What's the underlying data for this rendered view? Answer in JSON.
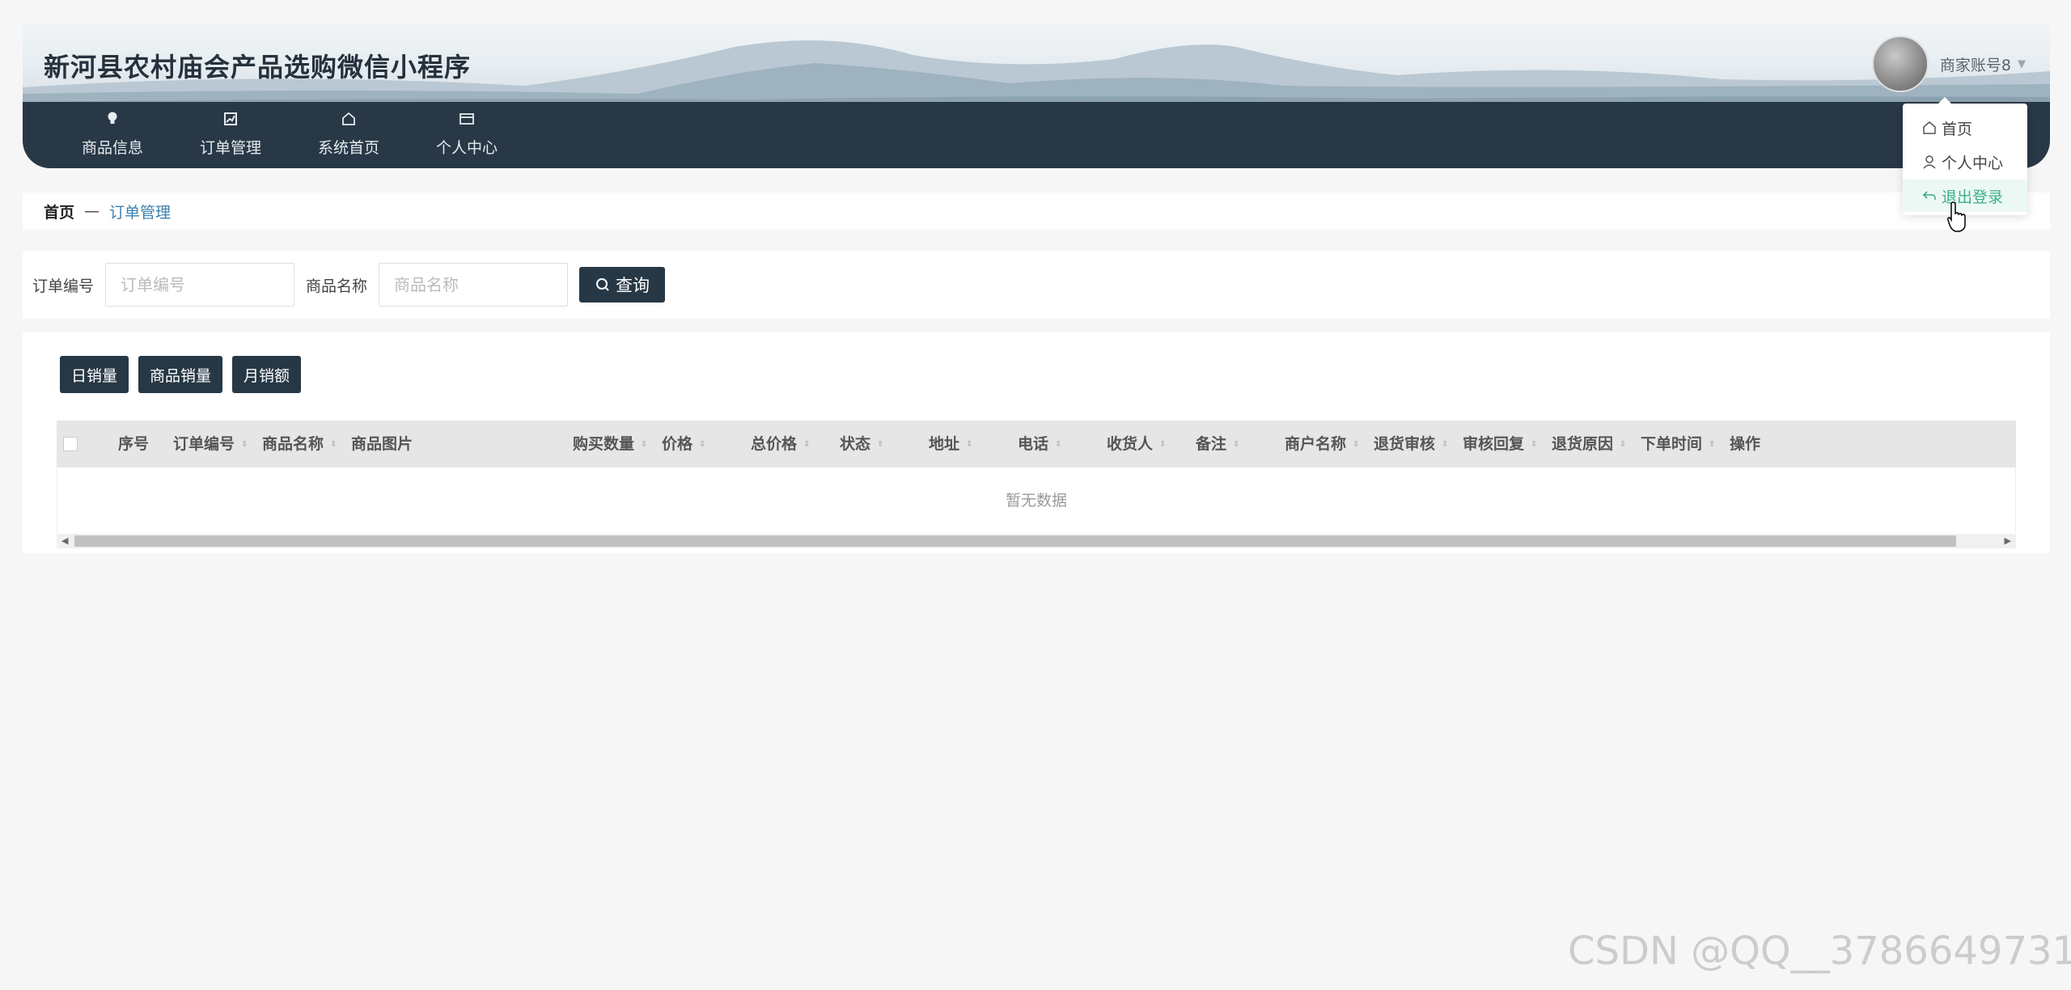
{
  "header": {
    "app_title": "新河县农村庙会产品选购微信小程序",
    "username": "商家账号8"
  },
  "nav": {
    "items": [
      {
        "label": "商品信息",
        "icon": "lightbulb-icon"
      },
      {
        "label": "订单管理",
        "icon": "chart-icon"
      },
      {
        "label": "系统首页",
        "icon": "home-icon"
      },
      {
        "label": "个人中心",
        "icon": "wallet-icon"
      }
    ]
  },
  "dropdown": {
    "items": [
      {
        "label": "首页",
        "icon": "home-icon"
      },
      {
        "label": "个人中心",
        "icon": "user-icon"
      },
      {
        "label": "退出登录",
        "icon": "logout-icon",
        "active": true
      }
    ],
    "active_color": "#3cae8c"
  },
  "breadcrumb": {
    "home": "首页",
    "separator": "—",
    "current": "订单管理"
  },
  "search": {
    "order_no_label": "订单编号",
    "order_no_placeholder": "订单编号",
    "order_no_value": "",
    "product_name_label": "商品名称",
    "product_name_placeholder": "商品名称",
    "product_name_value": "",
    "button_label": "查询"
  },
  "actions": {
    "daily_sales": "日销量",
    "product_sales": "商品销量",
    "monthly_revenue": "月销额"
  },
  "table": {
    "columns": [
      "序号",
      "订单编号",
      "商品名称",
      "商品图片",
      "购买数量",
      "价格",
      "总价格",
      "状态",
      "地址",
      "电话",
      "收货人",
      "备注",
      "商户名称",
      "退货审核",
      "审核回复",
      "退货原因",
      "下单时间",
      "操作"
    ],
    "rows": [],
    "empty_text": "暂无数据"
  },
  "watermark": "CSDN @QQ__3786649731",
  "colors": {
    "primary_dark": "#263846",
    "accent_link": "#3a7fae"
  }
}
